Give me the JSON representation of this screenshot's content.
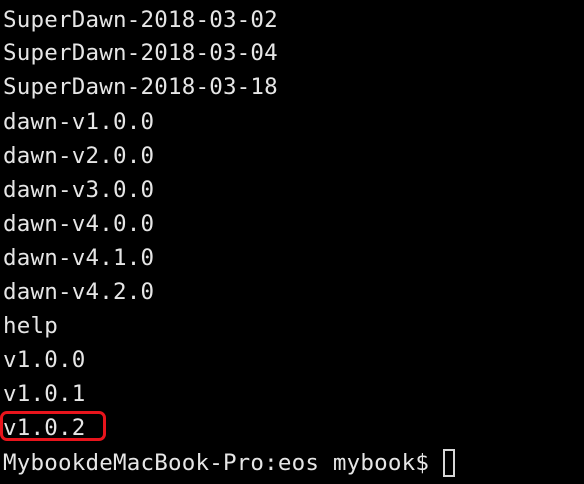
{
  "terminal": {
    "lines": [
      "SuperDawn-2018-03-02",
      "SuperDawn-2018-03-04",
      "SuperDawn-2018-03-18",
      "dawn-v1.0.0",
      "dawn-v2.0.0",
      "dawn-v3.0.0",
      "dawn-v4.0.0",
      "dawn-v4.1.0",
      "dawn-v4.2.0",
      "help",
      "v1.0.0",
      "v1.0.1",
      "v1.0.2"
    ],
    "highlighted_line": "v1.0.2",
    "prompt": "MybookdeMacBook-Pro:eos mybook$",
    "colors": {
      "background": "#000000",
      "text": "#e6e6e6",
      "highlight": "#e8141c"
    }
  }
}
